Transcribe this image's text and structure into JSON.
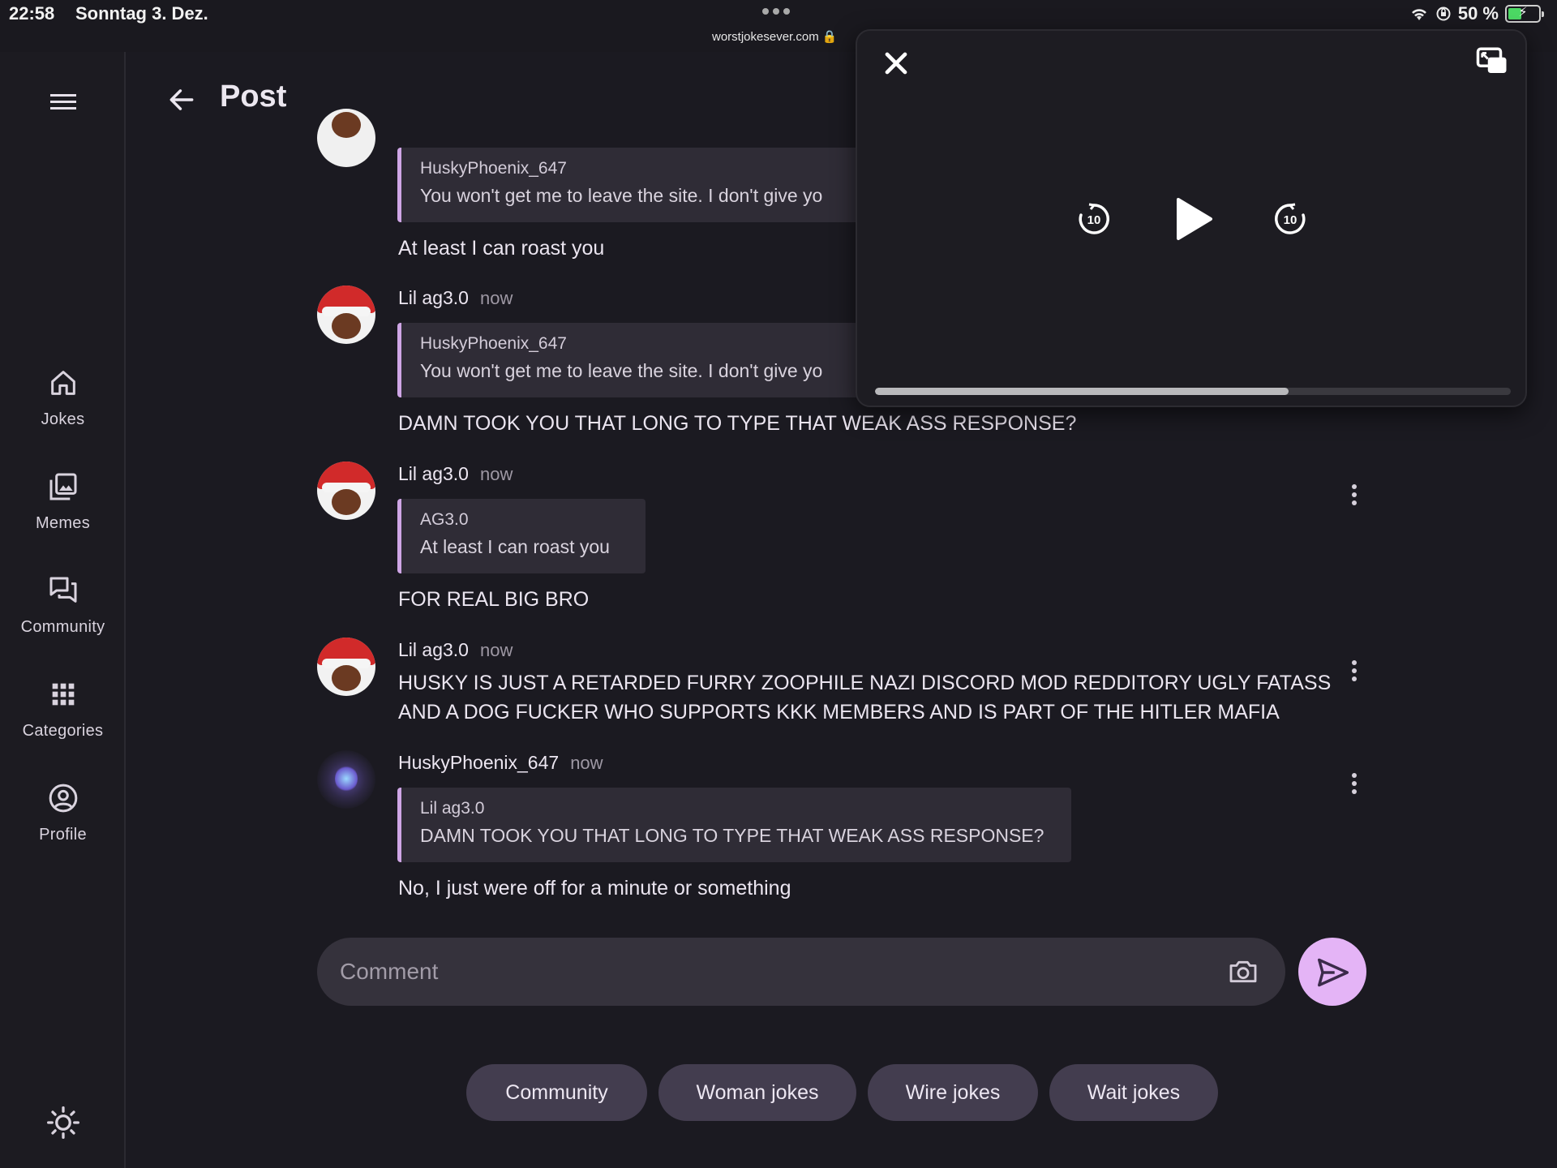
{
  "status_bar": {
    "time": "22:58",
    "date": "Sonntag 3. Dez.",
    "url": "worstjokesever.com",
    "battery": "50 %",
    "battery_level": 0.5
  },
  "sidebar": {
    "items": [
      {
        "label": "Jokes",
        "icon": "home-icon"
      },
      {
        "label": "Memes",
        "icon": "image-gallery-icon"
      },
      {
        "label": "Community",
        "icon": "chat-bubbles-icon"
      },
      {
        "label": "Categories",
        "icon": "grid-icon"
      },
      {
        "label": "Profile",
        "icon": "account-circle-icon"
      }
    ]
  },
  "header": {
    "title": "Post"
  },
  "comments": [
    {
      "quote": {
        "author": "HuskyPhoenix_647",
        "text": "You won't get me to leave the site. I don't give yo"
      },
      "text": "At least I can roast you"
    },
    {
      "author": "Lil ag3.0",
      "time": "now",
      "quote": {
        "author": "HuskyPhoenix_647",
        "text": "You won't get me to leave the site. I don't give yo"
      },
      "text": "DAMN TOOK YOU THAT LONG TO TYPE THAT WEAK ASS RESPONSE?"
    },
    {
      "author": "Lil ag3.0",
      "time": "now",
      "quote": {
        "author": "AG3.0",
        "text": "At least I can roast you"
      },
      "text": "FOR REAL BIG BRO"
    },
    {
      "author": "Lil ag3.0",
      "time": "now",
      "text_line1": "HUSKY IS JUST A RETARDED FURRY ZOOPHILE NAZI DISCORD MOD REDDITORY UGLY FATASS",
      "text_line2": "AND A DOG FUCKER WHO SUPPORTS KKK MEMBERS AND IS PART OF THE HITLER MAFIA"
    },
    {
      "author": "HuskyPhoenix_647",
      "time": "now",
      "quote": {
        "author": "Lil ag3.0",
        "text": "DAMN TOOK YOU THAT LONG TO TYPE THAT WEAK ASS RESPONSE?"
      },
      "text": "No, I just were off for a minute or something"
    }
  ],
  "comment_input": {
    "placeholder": "Comment",
    "value": ""
  },
  "chips": [
    "Community",
    "Woman jokes",
    "Wire jokes",
    "Wait jokes"
  ],
  "video_player": {
    "rewind_seconds": "10",
    "forward_seconds": "10",
    "progress": 0.65
  },
  "colors": {
    "background": "#1b1a21",
    "accent": "#e4b4f6",
    "quote_border": "#cfa6e6",
    "chip": "#433d4f"
  }
}
